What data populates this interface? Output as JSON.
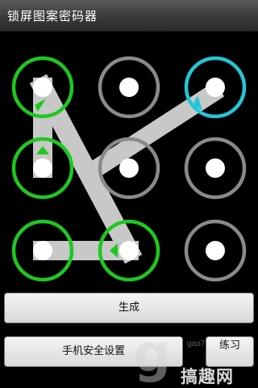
{
  "window": {
    "title": "锁屏图案密码器"
  },
  "pattern": {
    "rows": 3,
    "cols": 3,
    "colors": {
      "ring_idle": "#8a8a8a",
      "ring_active": "#1ec81e",
      "ring_current": "#23c6d6",
      "center": "#ffffff",
      "path": "#c8c8c8",
      "arrow_active": "#1ec81e",
      "arrow_current": "#23c6d6"
    },
    "dots": [
      {
        "id": 1,
        "state": "active",
        "arrow": "se"
      },
      {
        "id": 2,
        "state": "idle"
      },
      {
        "id": 3,
        "state": "current",
        "arrow": "sw"
      },
      {
        "id": 4,
        "state": "active",
        "arrow": "n"
      },
      {
        "id": 5,
        "state": "idle"
      },
      {
        "id": 6,
        "state": "idle"
      },
      {
        "id": 7,
        "state": "active"
      },
      {
        "id": 8,
        "state": "active",
        "arrow": "w"
      },
      {
        "id": 9,
        "state": "idle"
      }
    ],
    "sequence": [
      4,
      1,
      8,
      7
    ]
  },
  "buttons": {
    "generate_label": "生成",
    "security_label": "手机安全设置",
    "practice_label": "练习"
  },
  "watermark": {
    "site": "gao7.com",
    "brand": "搞趣网",
    "logo_letter": "g"
  }
}
